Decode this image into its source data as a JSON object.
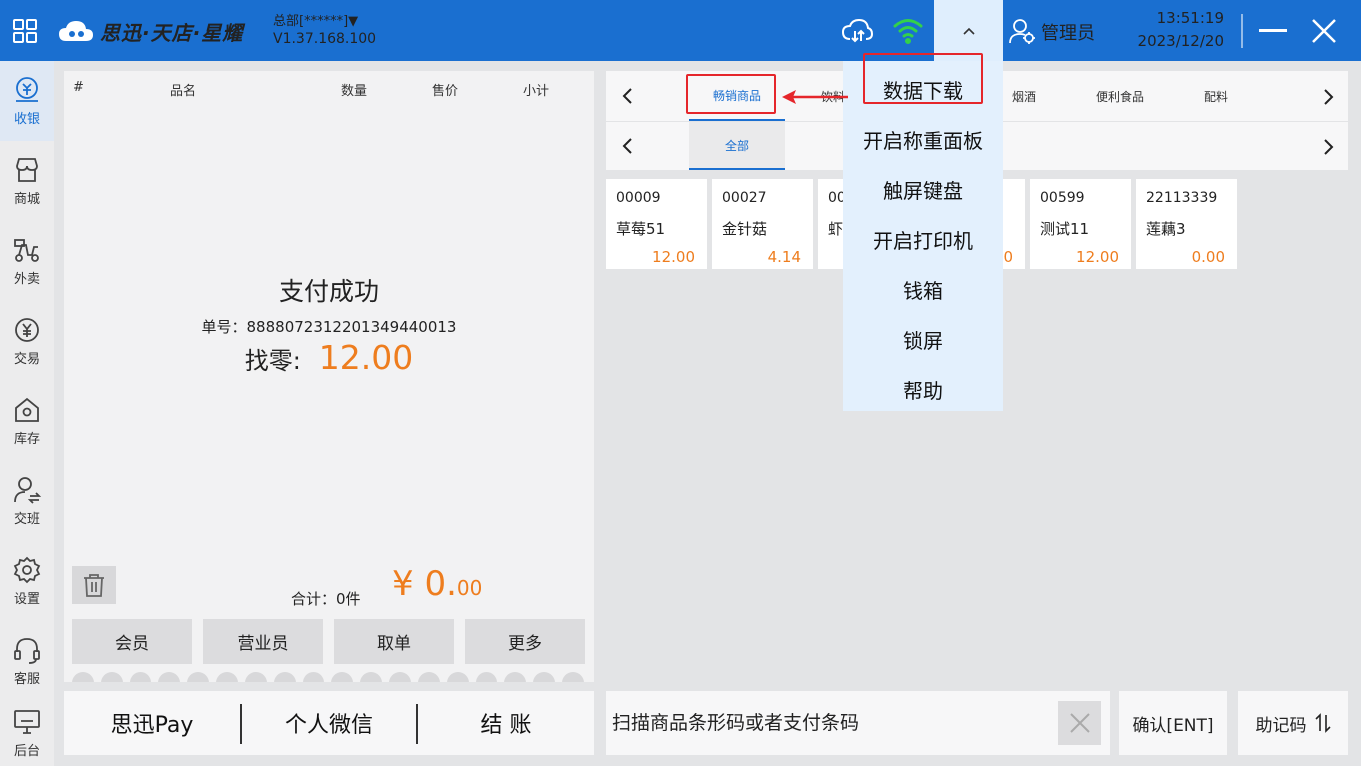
{
  "topbar": {
    "brand": "思迅·天店·星耀",
    "store_name": "总部[******]▼",
    "version": "V1.37.168.100",
    "admin": "管理员",
    "time": "13:51:19",
    "date": "2023/12/20"
  },
  "sidebar": {
    "items": [
      {
        "label": "收银",
        "icon": "cashier-icon"
      },
      {
        "label": "商城",
        "icon": "shop-icon"
      },
      {
        "label": "外卖",
        "icon": "delivery-icon"
      },
      {
        "label": "交易",
        "icon": "yuan-icon"
      },
      {
        "label": "库存",
        "icon": "home-icon"
      },
      {
        "label": "交班",
        "icon": "handover-icon"
      },
      {
        "label": "设置",
        "icon": "gear-icon"
      },
      {
        "label": "客服",
        "icon": "headset-icon"
      },
      {
        "label": "后台",
        "icon": "monitor-icon"
      }
    ]
  },
  "order_table": {
    "headers": [
      "#",
      "品名",
      "数量",
      "售价",
      "小计"
    ]
  },
  "payment": {
    "title": "支付成功",
    "order_no": "单号：8888072312201349440013",
    "change_label": "找零:",
    "change_value": "12.00"
  },
  "totals": {
    "count_label": "合计：0件",
    "amount_main": "¥ 0.",
    "amount_dec": "00"
  },
  "actions": [
    "会员",
    "营业员",
    "取单",
    "更多"
  ],
  "paybar": [
    "思迅Pay",
    "个人微信",
    "结  账"
  ],
  "categories": [
    {
      "label": "畅销商品"
    },
    {
      "label": "饮料"
    },
    {
      "label": "烟酒"
    },
    {
      "label": "便利食品"
    },
    {
      "label": "配料"
    }
  ],
  "subcategories": [
    {
      "label": "全部"
    }
  ],
  "products": [
    {
      "code": "00009",
      "name": "草莓51",
      "price": "12.00"
    },
    {
      "code": "00027",
      "name": "金针菇",
      "price": "4.14"
    },
    {
      "code": "00",
      "name": "虾",
      "price": ""
    },
    {
      "code": "",
      "name": "",
      "price": "0"
    },
    {
      "code": "00599",
      "name": "测试11",
      "price": "12.00"
    },
    {
      "code": "22113339",
      "name": "莲藕3",
      "price": "0.00"
    }
  ],
  "dropdown": {
    "items": [
      "数据下载",
      "开启称重面板",
      "触屏键盘",
      "开启打印机",
      "钱箱",
      "锁屏",
      "帮助"
    ]
  },
  "scan": {
    "placeholder": "扫描商品条形码或者支付条码"
  },
  "confirm_label": "确认[ENT]",
  "mnemonic_label": "助记码",
  "colors": {
    "brand_blue": "#1a6fd0",
    "accent_orange": "#ee7d1e",
    "annotation_red": "#e5262b"
  }
}
